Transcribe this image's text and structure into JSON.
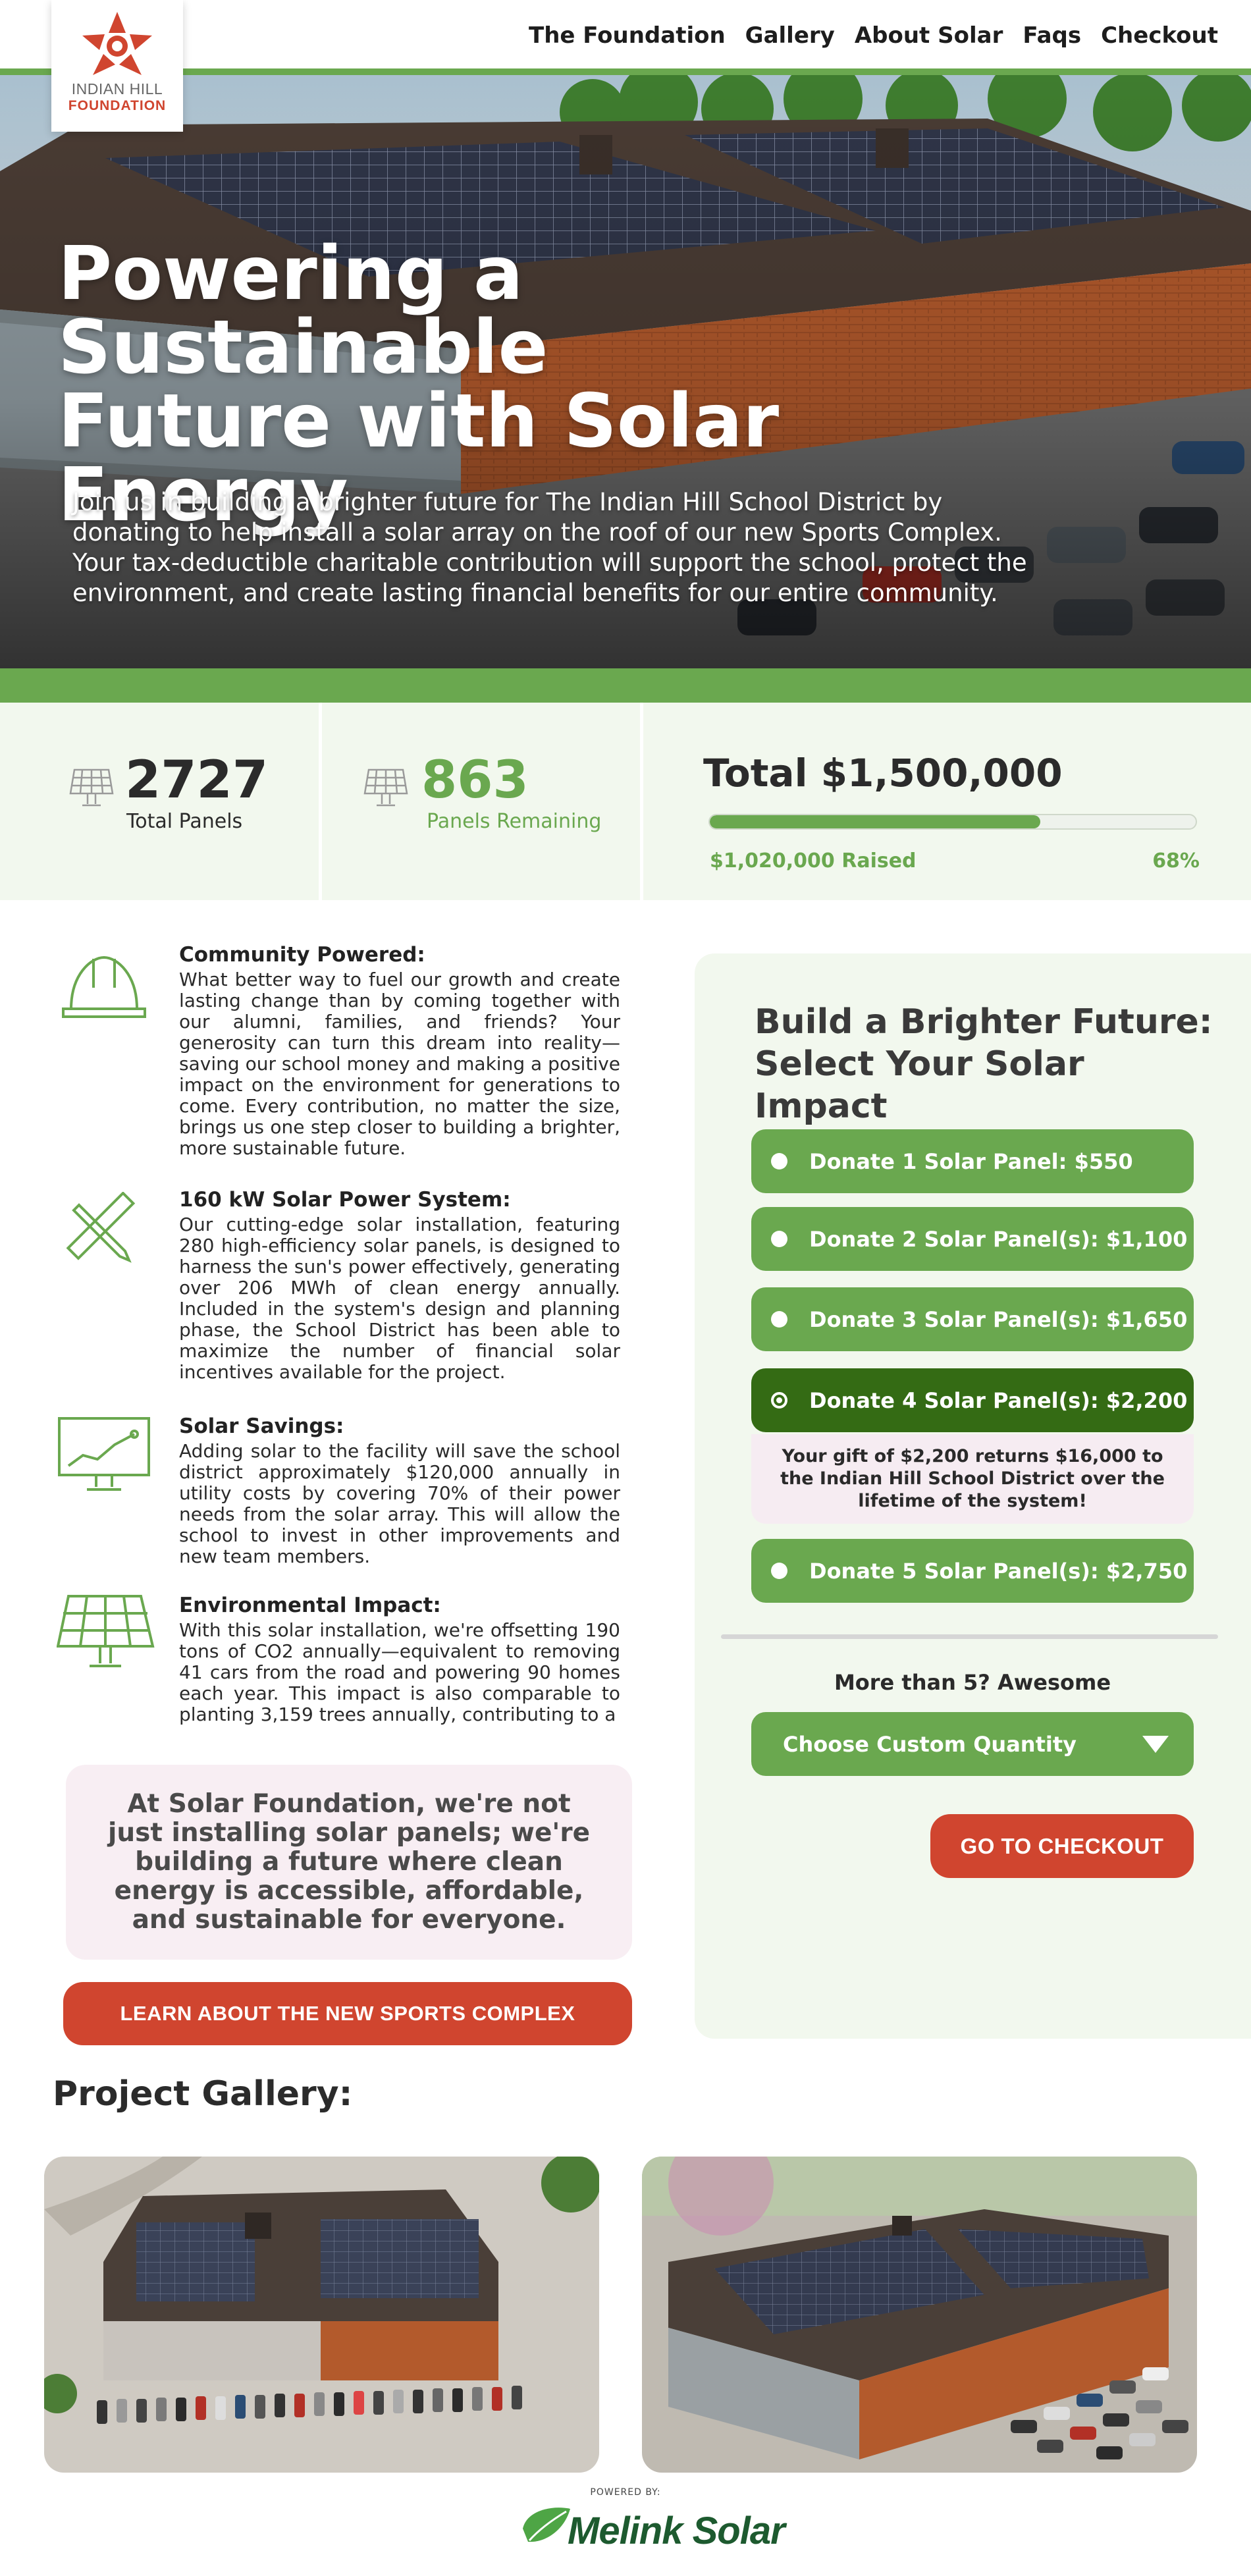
{
  "logo": {
    "line1": "INDIAN HILL",
    "line2": "FOUNDATION"
  },
  "nav": {
    "items": [
      "The Foundation",
      "Gallery",
      "About Solar",
      "Faqs",
      "Checkout"
    ]
  },
  "hero": {
    "title": "Powering a Sustainable Future with Solar Energy",
    "subtitle": "Join us in building a brighter future for The Indian Hill School District by donating to help install a solar array on the roof of our new Sports Complex. Your tax-deductible charitable contribution will support the school, protect the environment, and create lasting financial benefits for our entire community."
  },
  "stats": {
    "total_panels": "2727",
    "total_panels_label": "Total Panels",
    "remaining": "863",
    "remaining_label": "Panels Remaining",
    "total": "Total $1,500,000",
    "raised": "$1,020,000 Raised",
    "percent_label": "68%",
    "progress": 0.68
  },
  "features": [
    {
      "title": "Community Powered:",
      "body": "What better way to fuel our growth and create lasting change than by coming together with our alumni, families, and friends? Your generosity can turn this dream into reality—saving our school money and making a positive impact on the environment for generations to come. Every contribution, no matter the size, brings us one step closer to building a brighter, more sustainable future.",
      "icon": "hardhat-icon"
    },
    {
      "title": "160 kW Solar Power System:",
      "body": "Our cutting-edge solar installation, featuring 280 high-efficiency solar panels, is designed to harness the sun's power effectively, generating over 206 MWh of clean energy annually. Included in the system's design and planning phase, the School District has been able to maximize the number of financial solar incentives available for the project.",
      "icon": "ruler-pencil-icon"
    },
    {
      "title": "Solar Savings:",
      "body": "Adding solar to the facility will save the school district approximately $120,000 annually in utility costs by covering 70% of their power needs from the solar array. This will allow the school to invest in other improvements and new team members.",
      "icon": "monitor-chart-icon"
    },
    {
      "title": "Environmental Impact:",
      "body": "With this solar installation, we're offsetting 190 tons of CO2 annually—equivalent to removing 41 cars from the road and powering 90 homes each year. This impact is also comparable to planting 3,159 trees annually, contributing to a",
      "icon": "solar-panel-icon"
    }
  ],
  "quote": "At Solar Foundation, we're not just installing solar panels; we're building a future where clean energy is accessible, affordable, and sustainable for everyone.",
  "learn_button": "LEARN ABOUT THE NEW SPORTS COMPLEX",
  "donate": {
    "title": "Build a Brighter Future: Select Your Solar Impact",
    "options": [
      "Donate 1 Solar Panel: $550",
      "Donate 2 Solar Panel(s): $1,100",
      "Donate 3 Solar Panel(s): $1,650",
      "Donate 4 Solar Panel(s): $2,200",
      "Donate 5 Solar Panel(s): $2,750"
    ],
    "selected_index": 3,
    "gift_note": "Your gift of $2,200 returns $16,000 to the Indian Hill School District over the lifetime of the system!",
    "more_than": "More than 5? Awesome",
    "custom_select": "Choose Custom Quantity",
    "checkout": "GO TO CHECKOUT"
  },
  "gallery": {
    "title": "Project Gallery:"
  },
  "footer": {
    "powered_by": "POWERED BY:",
    "brand": "Melink Solar"
  },
  "colors": {
    "green": "#6aa84f",
    "dark_green": "#346b14",
    "red": "#d0452f",
    "light_green_bg": "#f2f8ee",
    "pink_bg": "#f8eef3"
  }
}
